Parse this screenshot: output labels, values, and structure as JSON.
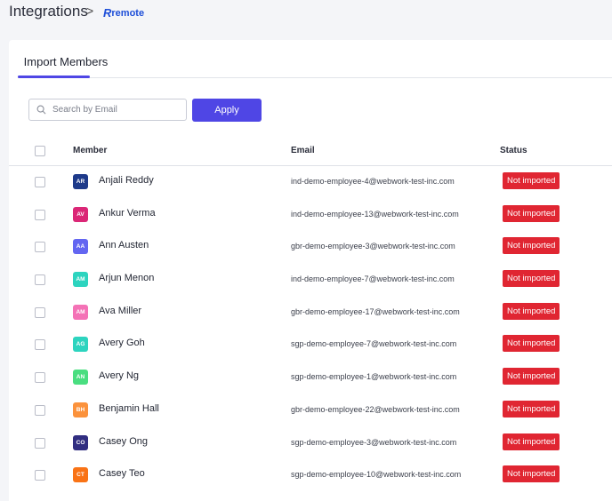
{
  "breadcrumb": {
    "title": "Integrations",
    "separator": ">",
    "brand_mark": "R",
    "brand_name": "remote"
  },
  "tabs": [
    {
      "label": "Import Members",
      "active": true
    }
  ],
  "search": {
    "placeholder": "Search by Email",
    "value": "",
    "icon": "search-icon"
  },
  "apply_label": "Apply",
  "colors": {
    "accent": "#4f46e5",
    "status_red": "#e02632",
    "brand": "#1d4ed8"
  },
  "table": {
    "headers": {
      "member": "Member",
      "email": "Email",
      "status": "Status"
    },
    "rows": [
      {
        "initials": "AR",
        "name": "Anjali Reddy",
        "email": "ind-demo-employee-4@webwork-test-inc.com",
        "status": "Not imported",
        "avatar_color": "#1e3a8a"
      },
      {
        "initials": "AV",
        "name": "Ankur Verma",
        "email": "ind-demo-employee-13@webwork-test-inc.com",
        "status": "Not imported",
        "avatar_color": "#db2777"
      },
      {
        "initials": "AA",
        "name": "Ann Austen",
        "email": "gbr-demo-employee-3@webwork-test-inc.com",
        "status": "Not imported",
        "avatar_color": "#6366f1"
      },
      {
        "initials": "AM",
        "name": "Arjun Menon",
        "email": "ind-demo-employee-7@webwork-test-inc.com",
        "status": "Not imported",
        "avatar_color": "#2dd4bf"
      },
      {
        "initials": "AM",
        "name": "Ava Miller",
        "email": "gbr-demo-employee-17@webwork-test-inc.com",
        "status": "Not imported",
        "avatar_color": "#f472b6"
      },
      {
        "initials": "AG",
        "name": "Avery Goh",
        "email": "sgp-demo-employee-7@webwork-test-inc.com",
        "status": "Not imported",
        "avatar_color": "#2dd4bf"
      },
      {
        "initials": "AN",
        "name": "Avery Ng",
        "email": "sgp-demo-employee-1@webwork-test-inc.com",
        "status": "Not imported",
        "avatar_color": "#4ade80"
      },
      {
        "initials": "BH",
        "name": "Benjamin Hall",
        "email": "gbr-demo-employee-22@webwork-test-inc.com",
        "status": "Not imported",
        "avatar_color": "#fb923c"
      },
      {
        "initials": "CO",
        "name": "Casey Ong",
        "email": "sgp-demo-employee-3@webwork-test-inc.com",
        "status": "Not imported",
        "avatar_color": "#312e81"
      },
      {
        "initials": "CT",
        "name": "Casey Teo",
        "email": "sgp-demo-employee-10@webwork-test-inc.com",
        "status": "Not imported",
        "avatar_color": "#f97316"
      }
    ]
  }
}
